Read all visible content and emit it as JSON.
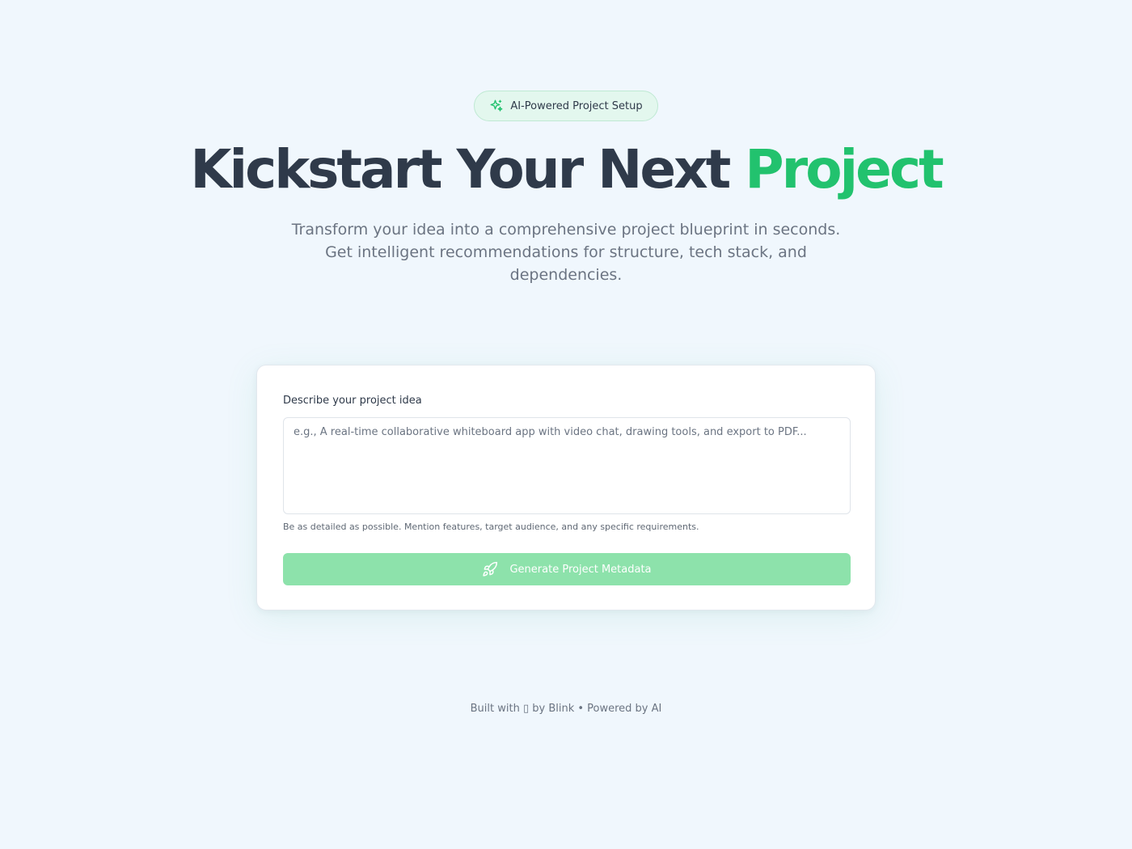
{
  "badge": {
    "label": "AI-Powered Project Setup",
    "icon": "sparkles-icon"
  },
  "hero": {
    "title_main": "Kickstart Your Next",
    "title_accent": "Project",
    "subtitle": "Transform your idea into a comprehensive project blueprint in seconds. Get intelligent recommendations for structure, tech stack, and dependencies."
  },
  "form": {
    "label": "Describe your project idea",
    "value": "",
    "placeholder": "e.g., A real-time collaborative whiteboard app with video chat, drawing tools, and export to PDF...",
    "hint": "Be as detailed as possible. Mention features, target audience, and any specific requirements.",
    "button_label": "Generate Project Metadata",
    "button_icon": "rocket-icon"
  },
  "footer": {
    "text": "Built with ▯ by Blink • Powered by AI"
  },
  "colors": {
    "background": "#f0f7fd",
    "accent": "#22c26e",
    "button": "#8de2ab",
    "badge_bg": "#e3f7ee",
    "heading": "#2f3a4a"
  }
}
